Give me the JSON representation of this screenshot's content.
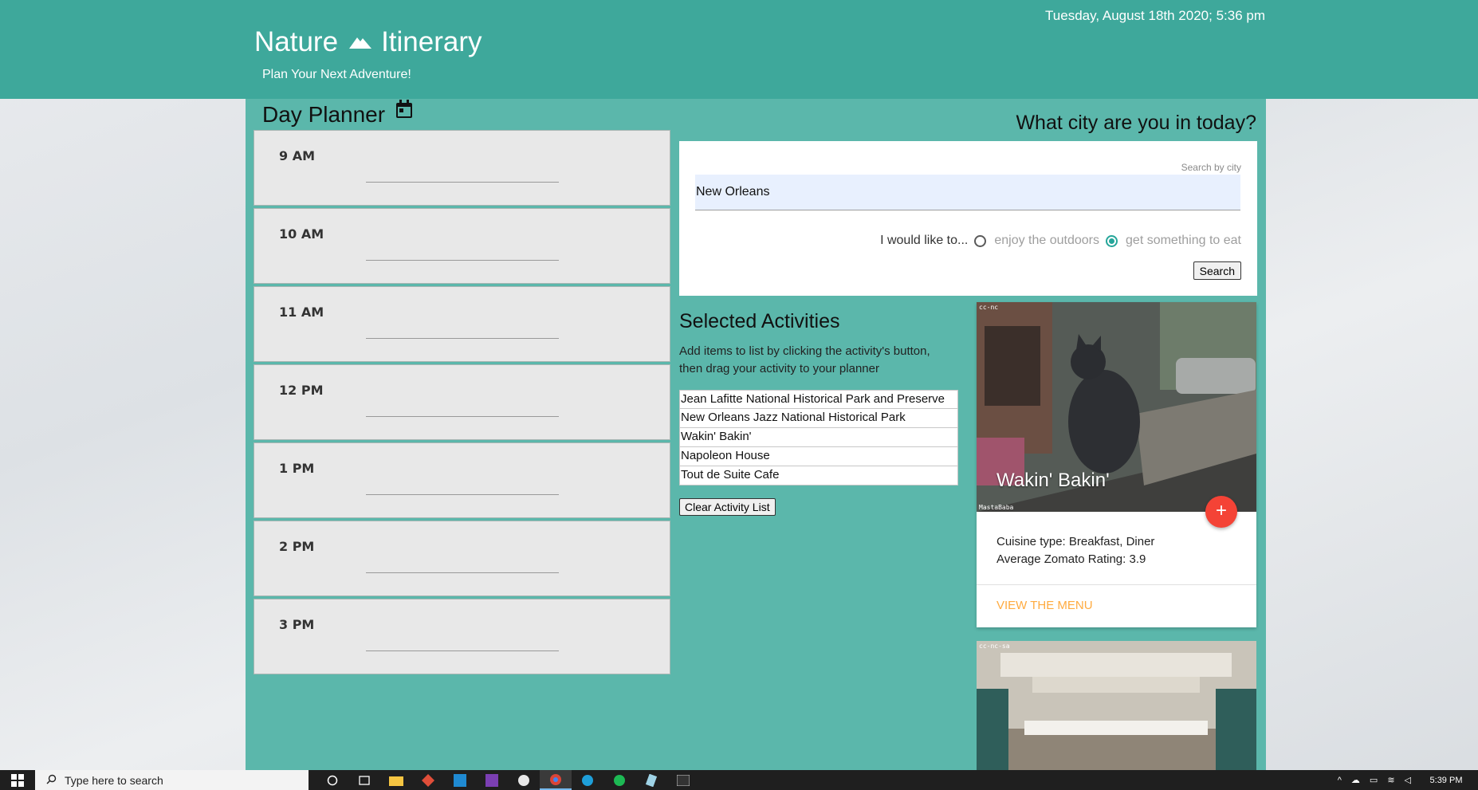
{
  "header": {
    "brand_left": "Nature",
    "brand_right": "Itinerary",
    "tagline": "Plan Your Next Adventure!",
    "datetime": "Tuesday, August 18th 2020; 5:36 pm"
  },
  "planner": {
    "title": "Day Planner",
    "slots": [
      "9 AM",
      "10 AM",
      "11 AM",
      "12 PM",
      "1 PM",
      "2 PM",
      "3 PM"
    ]
  },
  "search": {
    "question": "What city are you in today?",
    "field_label": "Search by city",
    "city_value": "New Orleans",
    "prompt": "I would like to...",
    "options": [
      "enjoy the outdoors",
      "get something to eat"
    ],
    "selected_option": "get something to eat",
    "button_label": "Search"
  },
  "activities": {
    "title": "Selected Activities",
    "description": "Add items to list by clicking the activity's button, then drag your activity to your planner",
    "items": [
      "Jean Lafitte National Historical Park and Preserve",
      "New Orleans Jazz National Historical Park",
      "Wakin' Bakin'",
      "Napoleon House",
      "Tout de Suite Cafe"
    ],
    "clear_label": "Clear Activity List"
  },
  "cards": [
    {
      "name": "Wakin' Bakin'",
      "license_mark": "cc-nc",
      "photo_credit": "MastaBaba",
      "add_button": "+",
      "cuisine": "Cuisine type: Breakfast, Diner",
      "rating": "Average Zomato Rating: 3.9",
      "link": "VIEW THE MENU"
    },
    {
      "license_mark": "cc-nc-sa"
    }
  ],
  "taskbar": {
    "search_placeholder": "Type here to search",
    "time": "5:39 PM"
  },
  "colors": {
    "header": "#3ea89b",
    "panel": "#5bb7ab",
    "accent": "#26a69a",
    "fab": "#f44336",
    "link": "#ffab40"
  }
}
